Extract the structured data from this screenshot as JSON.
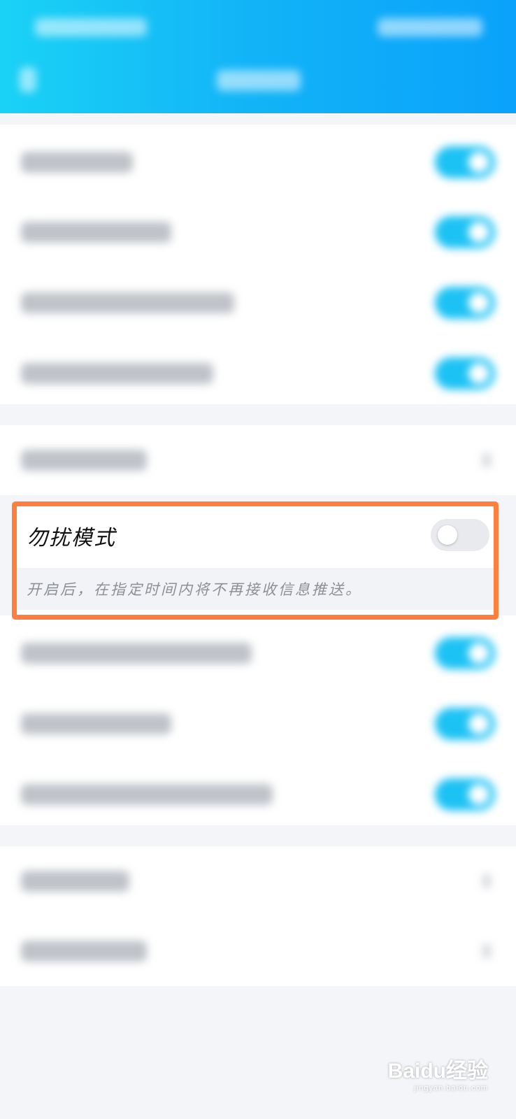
{
  "dnd": {
    "label": "勿扰模式",
    "enabled": false,
    "description": "开启后，在指定时间内将不再接收信息推送。"
  },
  "watermark": {
    "brand": "Baidu经验",
    "domain": "jingyan.baidu.com"
  },
  "colors": {
    "header_gradient_start": "#1ad2f6",
    "header_gradient_end": "#0aa2fb",
    "toggle_on": "#1cc2f4",
    "highlight_border": "#ff7f3f"
  }
}
